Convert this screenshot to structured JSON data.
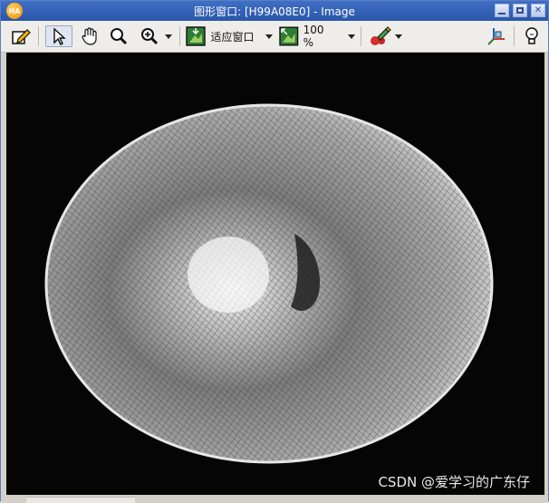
{
  "window": {
    "title": "图形窗口: [H99A08E0] - Image",
    "app_icon_text": "HA"
  },
  "toolbar": {
    "fit_window_label": "适应窗口",
    "zoom_label": "100 %"
  },
  "canvas": {
    "watermark": "CSDN @爱学习的广东仔"
  },
  "colors": {
    "titlebar": "#2f5fb8",
    "toolbar_bg": "#efedea",
    "canvas_bg": "#050505"
  },
  "icons": [
    "edit-icon",
    "arrow-pointer-icon",
    "hand-pan-icon",
    "magnifier-icon",
    "zoom-plus-icon",
    "fit-window-icon",
    "zoom-100-icon",
    "color-pick-icon",
    "axis-3d-icon",
    "lightbulb-icon"
  ]
}
